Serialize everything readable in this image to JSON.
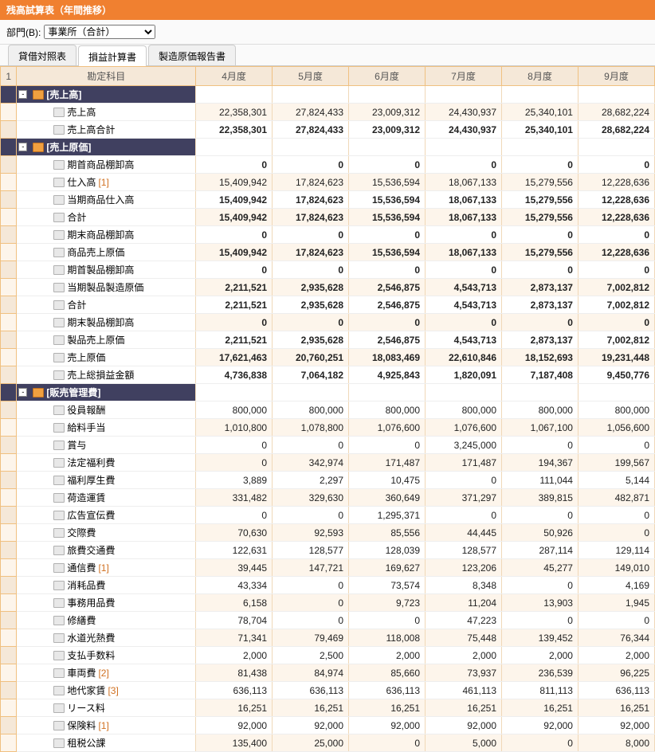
{
  "title": "残高試算表（年間推移）",
  "filter": {
    "label": "部門(B):",
    "options": [
      "事業所（合計）"
    ],
    "selected": "事業所（合計）"
  },
  "tabs": [
    "貸借対照表",
    "損益計算書",
    "製造原価報告書"
  ],
  "activeTab": 1,
  "columns": [
    "勘定科目",
    "4月度",
    "5月度",
    "6月度",
    "7月度",
    "8月度",
    "9月度"
  ],
  "rownum_header": "1",
  "rows": [
    {
      "type": "header",
      "depth": 0,
      "label": "[売上高]",
      "icon": "folder",
      "toggle": "-"
    },
    {
      "depth": 1,
      "label": "売上高",
      "icon": "doc",
      "v": [
        "22,358,301",
        "27,824,433",
        "23,009,312",
        "24,430,937",
        "25,340,101",
        "28,682,224"
      ]
    },
    {
      "depth": 1,
      "label": "売上高合計",
      "icon": "doc",
      "bold": true,
      "v": [
        "22,358,301",
        "27,824,433",
        "23,009,312",
        "24,430,937",
        "25,340,101",
        "28,682,224"
      ]
    },
    {
      "type": "header",
      "depth": 0,
      "label": "[売上原価]",
      "icon": "folder",
      "toggle": "-"
    },
    {
      "depth": 1,
      "label": "期首商品棚卸高",
      "icon": "doc",
      "bold": true,
      "v": [
        "0",
        "0",
        "0",
        "0",
        "0",
        "0"
      ]
    },
    {
      "depth": 1,
      "label": "仕入高",
      "suffix": "[1]",
      "icon": "doc",
      "v": [
        "15,409,942",
        "17,824,623",
        "15,536,594",
        "18,067,133",
        "15,279,556",
        "12,228,636"
      ]
    },
    {
      "depth": 1,
      "label": "当期商品仕入高",
      "icon": "doc",
      "bold": true,
      "v": [
        "15,409,942",
        "17,824,623",
        "15,536,594",
        "18,067,133",
        "15,279,556",
        "12,228,636"
      ]
    },
    {
      "depth": 1,
      "label": "合計",
      "icon": "doc",
      "bold": true,
      "v": [
        "15,409,942",
        "17,824,623",
        "15,536,594",
        "18,067,133",
        "15,279,556",
        "12,228,636"
      ]
    },
    {
      "depth": 1,
      "label": "期末商品棚卸高",
      "icon": "doc",
      "bold": true,
      "v": [
        "0",
        "0",
        "0",
        "0",
        "0",
        "0"
      ]
    },
    {
      "depth": 1,
      "label": "商品売上原価",
      "icon": "doc",
      "bold": true,
      "v": [
        "15,409,942",
        "17,824,623",
        "15,536,594",
        "18,067,133",
        "15,279,556",
        "12,228,636"
      ]
    },
    {
      "depth": 1,
      "label": "期首製品棚卸高",
      "icon": "doc",
      "bold": true,
      "v": [
        "0",
        "0",
        "0",
        "0",
        "0",
        "0"
      ]
    },
    {
      "depth": 1,
      "label": "当期製品製造原価",
      "icon": "doc",
      "bold": true,
      "v": [
        "2,211,521",
        "2,935,628",
        "2,546,875",
        "4,543,713",
        "2,873,137",
        "7,002,812"
      ]
    },
    {
      "depth": 1,
      "label": "合計",
      "icon": "doc",
      "bold": true,
      "v": [
        "2,211,521",
        "2,935,628",
        "2,546,875",
        "4,543,713",
        "2,873,137",
        "7,002,812"
      ]
    },
    {
      "depth": 1,
      "label": "期末製品棚卸高",
      "icon": "doc",
      "bold": true,
      "v": [
        "0",
        "0",
        "0",
        "0",
        "0",
        "0"
      ]
    },
    {
      "depth": 1,
      "label": "製品売上原価",
      "icon": "doc",
      "bold": true,
      "v": [
        "2,211,521",
        "2,935,628",
        "2,546,875",
        "4,543,713",
        "2,873,137",
        "7,002,812"
      ]
    },
    {
      "depth": 1,
      "label": "売上原価",
      "icon": "doc",
      "bold": true,
      "v": [
        "17,621,463",
        "20,760,251",
        "18,083,469",
        "22,610,846",
        "18,152,693",
        "19,231,448"
      ]
    },
    {
      "depth": 1,
      "label": "売上総損益金額",
      "icon": "doc",
      "bold": true,
      "v": [
        "4,736,838",
        "7,064,182",
        "4,925,843",
        "1,820,091",
        "7,187,408",
        "9,450,776"
      ]
    },
    {
      "type": "header",
      "depth": 0,
      "label": "[販売管理費]",
      "icon": "folder",
      "toggle": "-"
    },
    {
      "depth": 1,
      "label": "役員報酬",
      "icon": "doc",
      "v": [
        "800,000",
        "800,000",
        "800,000",
        "800,000",
        "800,000",
        "800,000"
      ]
    },
    {
      "depth": 1,
      "label": "給料手当",
      "icon": "doc",
      "v": [
        "1,010,800",
        "1,078,800",
        "1,076,600",
        "1,076,600",
        "1,067,100",
        "1,056,600"
      ]
    },
    {
      "depth": 1,
      "label": "賞与",
      "icon": "doc",
      "v": [
        "0",
        "0",
        "0",
        "3,245,000",
        "0",
        "0"
      ]
    },
    {
      "depth": 1,
      "label": "法定福利費",
      "icon": "doc",
      "v": [
        "0",
        "342,974",
        "171,487",
        "171,487",
        "194,367",
        "199,567"
      ]
    },
    {
      "depth": 1,
      "label": "福利厚生費",
      "icon": "doc",
      "v": [
        "3,889",
        "2,297",
        "10,475",
        "0",
        "111,044",
        "5,144"
      ]
    },
    {
      "depth": 1,
      "label": "荷造運賃",
      "icon": "doc",
      "v": [
        "331,482",
        "329,630",
        "360,649",
        "371,297",
        "389,815",
        "482,871"
      ]
    },
    {
      "depth": 1,
      "label": "広告宣伝費",
      "icon": "doc",
      "v": [
        "0",
        "0",
        "1,295,371",
        "0",
        "0",
        "0"
      ]
    },
    {
      "depth": 1,
      "label": "交際費",
      "icon": "doc",
      "v": [
        "70,630",
        "92,593",
        "85,556",
        "44,445",
        "50,926",
        "0"
      ]
    },
    {
      "depth": 1,
      "label": "旅費交通費",
      "icon": "doc",
      "v": [
        "122,631",
        "128,577",
        "128,039",
        "128,577",
        "287,114",
        "129,114"
      ]
    },
    {
      "depth": 1,
      "label": "通信費",
      "suffix": "[1]",
      "icon": "doc",
      "v": [
        "39,445",
        "147,721",
        "169,627",
        "123,206",
        "45,277",
        "149,010"
      ]
    },
    {
      "depth": 1,
      "label": "消耗品費",
      "icon": "doc",
      "v": [
        "43,334",
        "0",
        "73,574",
        "8,348",
        "0",
        "4,169"
      ]
    },
    {
      "depth": 1,
      "label": "事務用品費",
      "icon": "doc",
      "v": [
        "6,158",
        "0",
        "9,723",
        "11,204",
        "13,903",
        "1,945"
      ]
    },
    {
      "depth": 1,
      "label": "修繕費",
      "icon": "doc",
      "v": [
        "78,704",
        "0",
        "0",
        "47,223",
        "0",
        "0"
      ]
    },
    {
      "depth": 1,
      "label": "水道光熱費",
      "icon": "doc",
      "v": [
        "71,341",
        "79,469",
        "118,008",
        "75,448",
        "139,452",
        "76,344"
      ]
    },
    {
      "depth": 1,
      "label": "支払手数料",
      "icon": "doc",
      "v": [
        "2,000",
        "2,500",
        "2,000",
        "2,000",
        "2,000",
        "2,000"
      ]
    },
    {
      "depth": 1,
      "label": "車両費",
      "suffix": "[2]",
      "icon": "doc",
      "v": [
        "81,438",
        "84,974",
        "85,660",
        "73,937",
        "236,539",
        "96,225"
      ]
    },
    {
      "depth": 1,
      "label": "地代家賃",
      "suffix": "[3]",
      "icon": "doc",
      "v": [
        "636,113",
        "636,113",
        "636,113",
        "461,113",
        "811,113",
        "636,113"
      ]
    },
    {
      "depth": 1,
      "label": "リース料",
      "icon": "doc",
      "v": [
        "16,251",
        "16,251",
        "16,251",
        "16,251",
        "16,251",
        "16,251"
      ]
    },
    {
      "depth": 1,
      "label": "保険料",
      "suffix": "[1]",
      "icon": "doc",
      "v": [
        "92,000",
        "92,000",
        "92,000",
        "92,000",
        "92,000",
        "92,000"
      ]
    },
    {
      "depth": 1,
      "label": "租税公課",
      "icon": "doc",
      "v": [
        "135,400",
        "25,000",
        "0",
        "5,000",
        "0",
        "8,000"
      ]
    }
  ]
}
